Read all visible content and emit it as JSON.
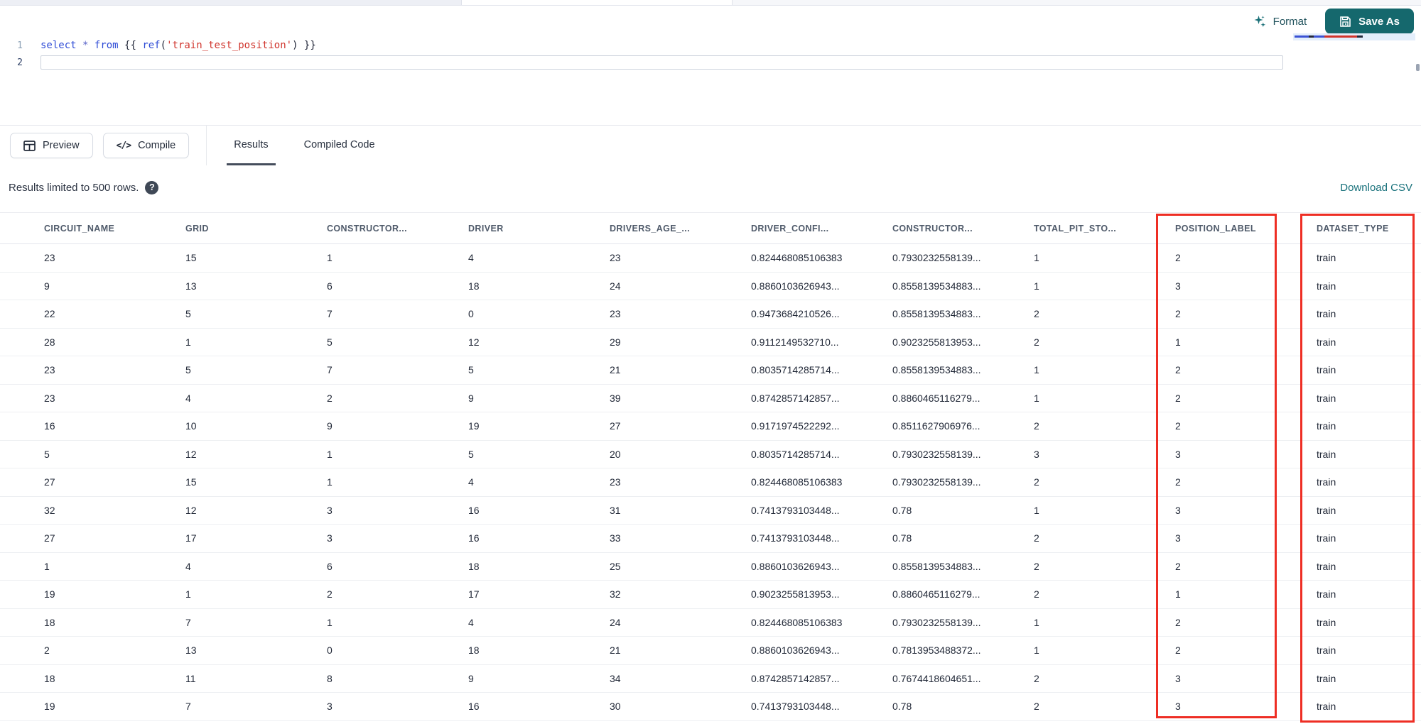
{
  "editor": {
    "line_numbers": [
      "1",
      "2"
    ],
    "code_tokens": [
      {
        "t": "select",
        "c": "kw"
      },
      {
        "t": " ",
        "c": "tx"
      },
      {
        "t": "*",
        "c": "op"
      },
      {
        "t": " ",
        "c": "tx"
      },
      {
        "t": "from",
        "c": "kw"
      },
      {
        "t": " {{ ",
        "c": "tx"
      },
      {
        "t": "ref",
        "c": "fn"
      },
      {
        "t": "(",
        "c": "tx"
      },
      {
        "t": "'train_test_position'",
        "c": "str"
      },
      {
        "t": ") }}",
        "c": "tx"
      }
    ],
    "format_label": "Format",
    "save_as_label": "Save As"
  },
  "toolbar": {
    "preview_label": "Preview",
    "compile_label": "Compile",
    "tabs": [
      {
        "label": "Results",
        "active": true
      },
      {
        "label": "Compiled Code",
        "active": false
      }
    ]
  },
  "results_bar": {
    "info": "Results limited to 500 rows.",
    "help_glyph": "?",
    "download_label": "Download CSV"
  },
  "table": {
    "columns": [
      "CIRCUIT_NAME",
      "GRID",
      "CONSTRUCTOR...",
      "DRIVER",
      "DRIVERS_AGE_...",
      "DRIVER_CONFI...",
      "CONSTRUCTOR...",
      "TOTAL_PIT_STO...",
      "POSITION_LABEL",
      "DATASET_TYPE"
    ],
    "rows": [
      [
        "23",
        "15",
        "1",
        "4",
        "23",
        "0.824468085106383",
        "0.7930232558139...",
        "1",
        "2",
        "train"
      ],
      [
        "9",
        "13",
        "6",
        "18",
        "24",
        "0.8860103626943...",
        "0.8558139534883...",
        "1",
        "3",
        "train"
      ],
      [
        "22",
        "5",
        "7",
        "0",
        "23",
        "0.9473684210526...",
        "0.8558139534883...",
        "2",
        "2",
        "train"
      ],
      [
        "28",
        "1",
        "5",
        "12",
        "29",
        "0.9112149532710...",
        "0.9023255813953...",
        "2",
        "1",
        "train"
      ],
      [
        "23",
        "5",
        "7",
        "5",
        "21",
        "0.8035714285714...",
        "0.8558139534883...",
        "1",
        "2",
        "train"
      ],
      [
        "23",
        "4",
        "2",
        "9",
        "39",
        "0.8742857142857...",
        "0.8860465116279...",
        "1",
        "2",
        "train"
      ],
      [
        "16",
        "10",
        "9",
        "19",
        "27",
        "0.9171974522292...",
        "0.8511627906976...",
        "2",
        "2",
        "train"
      ],
      [
        "5",
        "12",
        "1",
        "5",
        "20",
        "0.8035714285714...",
        "0.7930232558139...",
        "3",
        "3",
        "train"
      ],
      [
        "27",
        "15",
        "1",
        "4",
        "23",
        "0.824468085106383",
        "0.7930232558139...",
        "2",
        "2",
        "train"
      ],
      [
        "32",
        "12",
        "3",
        "16",
        "31",
        "0.7413793103448...",
        "0.78",
        "1",
        "3",
        "train"
      ],
      [
        "27",
        "17",
        "3",
        "16",
        "33",
        "0.7413793103448...",
        "0.78",
        "2",
        "3",
        "train"
      ],
      [
        "1",
        "4",
        "6",
        "18",
        "25",
        "0.8860103626943...",
        "0.8558139534883...",
        "2",
        "2",
        "train"
      ],
      [
        "19",
        "1",
        "2",
        "17",
        "32",
        "0.9023255813953...",
        "0.8860465116279...",
        "2",
        "1",
        "train"
      ],
      [
        "18",
        "7",
        "1",
        "4",
        "24",
        "0.824468085106383",
        "0.7930232558139...",
        "1",
        "2",
        "train"
      ],
      [
        "2",
        "13",
        "0",
        "18",
        "21",
        "0.8860103626943...",
        "0.7813953488372...",
        "1",
        "2",
        "train"
      ],
      [
        "18",
        "11",
        "8",
        "9",
        "34",
        "0.8742857142857...",
        "0.7674418604651...",
        "2",
        "3",
        "train"
      ],
      [
        "19",
        "7",
        "3",
        "16",
        "30",
        "0.7413793103448...",
        "0.78",
        "2",
        "3",
        "train"
      ]
    ]
  },
  "annotations": {
    "highlighted_columns": [
      "POSITION_LABEL",
      "DATASET_TYPE"
    ],
    "box_color": "#ee2e24"
  },
  "colors": {
    "accent_teal": "#15686d",
    "link_teal": "#16707a",
    "keyword_blue": "#2e4bd6",
    "string_red": "#d0342c",
    "header_text": "#4f5a6a",
    "body_text": "#222938",
    "row_border": "#edeff2"
  }
}
